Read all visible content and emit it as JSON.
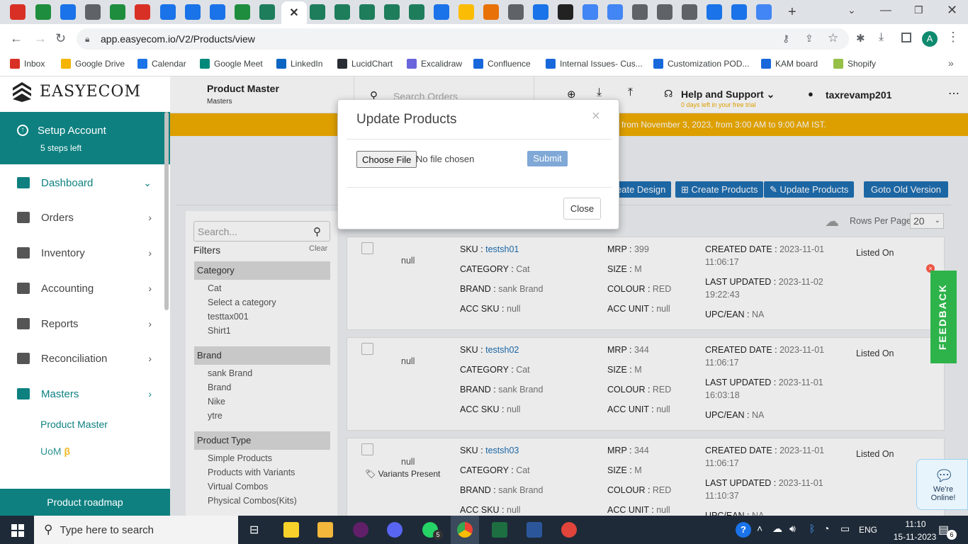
{
  "browser": {
    "url": "app.easyecom.io/V2/Products/view",
    "avatar": "A"
  },
  "bookmarks": [
    {
      "label": "Inbox",
      "color": "#d93025"
    },
    {
      "label": "Google Drive",
      "color": "#f4b400"
    },
    {
      "label": "Calendar",
      "color": "#1a73e8"
    },
    {
      "label": "Google Meet",
      "color": "#00897b"
    },
    {
      "label": "LinkedIn",
      "color": "#0a66c2"
    },
    {
      "label": "LucidChart",
      "color": "#282c33"
    },
    {
      "label": "Excalidraw",
      "color": "#6965db"
    },
    {
      "label": "Confluence",
      "color": "#1868db"
    },
    {
      "label": "Internal Issues- Cus...",
      "color": "#1868db"
    },
    {
      "label": "Customization POD...",
      "color": "#1868db"
    },
    {
      "label": "KAM board",
      "color": "#1868db"
    },
    {
      "label": "Shopify",
      "color": "#95bf47"
    }
  ],
  "app": {
    "logo": "EASYECOM",
    "page_title": "Product Master",
    "page_subtitle": "Masters",
    "search_placeholder": "Search Orders",
    "help": "Help and Support",
    "trial": "0 days left in your free trial",
    "user": "taxrevamp201",
    "banner": "from November 3, 2023, from 3:00 AM to 9:00 AM IST."
  },
  "sidebar": {
    "setup_title": "Setup Account",
    "setup_sub": "5 steps left",
    "items": [
      "Dashboard",
      "Orders",
      "Inventory",
      "Accounting",
      "Reports",
      "Reconciliation",
      "Masters"
    ],
    "sub_items": [
      "Product Master",
      "UoM"
    ],
    "beta": "β",
    "roadmap": "Product roadmap"
  },
  "actions": {
    "create_design": "eate Design",
    "create_products": "Create Products",
    "update_products": "Update Products",
    "old_version": "Goto Old Version",
    "rows_label": "Rows Per Page",
    "rows_value": "20"
  },
  "filters": {
    "search_placeholder": "Search...",
    "title": "Filters",
    "clear": "Clear",
    "category_head": "Category",
    "category": [
      "Cat",
      "Select a category",
      "testtax001",
      "Shirt1"
    ],
    "brand_head": "Brand",
    "brand": [
      "sank Brand",
      "Brand",
      "Nike",
      "ytre"
    ],
    "type_head": "Product Type",
    "types": [
      "Simple Products",
      "Products with Variants",
      "Virtual Combos",
      "Physical Combos(Kits)"
    ]
  },
  "labels": {
    "sku": "SKU :",
    "category": "CATEGORY :",
    "brand": "BRAND :",
    "acc_sku": "ACC SKU :",
    "mrp": "MRP :",
    "size": "SIZE :",
    "colour": "COLOUR :",
    "acc_unit": "ACC UNIT :",
    "created": "CREATED DATE :",
    "updated": "LAST UPDATED :",
    "upc": "UPC/EAN :",
    "listed": "Listed On",
    "variants": "Variants Present"
  },
  "products": [
    {
      "image": "null",
      "sku": "testsh01",
      "category": "Cat",
      "brand": "sank Brand",
      "acc_sku": "null",
      "mrp": "399",
      "size": "M",
      "colour": "RED",
      "acc_unit": "null",
      "created_date": "2023-11-01",
      "created_time": "11:06:17",
      "updated_date": "2023-11-02",
      "updated_time": "19:22:43",
      "upc": "NA"
    },
    {
      "image": "null",
      "sku": "testsh02",
      "category": "Cat",
      "brand": "sank Brand",
      "acc_sku": "null",
      "mrp": "344",
      "size": "M",
      "colour": "RED",
      "acc_unit": "null",
      "created_date": "2023-11-01",
      "created_time": "11:06:17",
      "updated_date": "2023-11-01",
      "updated_time": "16:03:18",
      "upc": "NA"
    },
    {
      "image": "null",
      "sku": "testsh03",
      "category": "Cat",
      "brand": "sank Brand",
      "acc_sku": "null",
      "mrp": "344",
      "size": "M",
      "colour": "RED",
      "acc_unit": "null",
      "created_date": "2023-11-01",
      "created_time": "11:06:17",
      "updated_date": "2023-11-01",
      "updated_time": "11:10:37",
      "upc": "NA"
    }
  ],
  "modal": {
    "title": "Update Products",
    "choose": "Choose File",
    "no_file": "No file chosen",
    "submit": "Submit",
    "close": "Close",
    "x": "×"
  },
  "widgets": {
    "feedback": "FEEDBACK",
    "chat": "We're Online!"
  },
  "taskbar": {
    "search": "Type here to search",
    "lang": "ENG",
    "time": "11:10",
    "date": "15-11-2023",
    "notif": "6",
    "whatsapp_badge": "5"
  }
}
